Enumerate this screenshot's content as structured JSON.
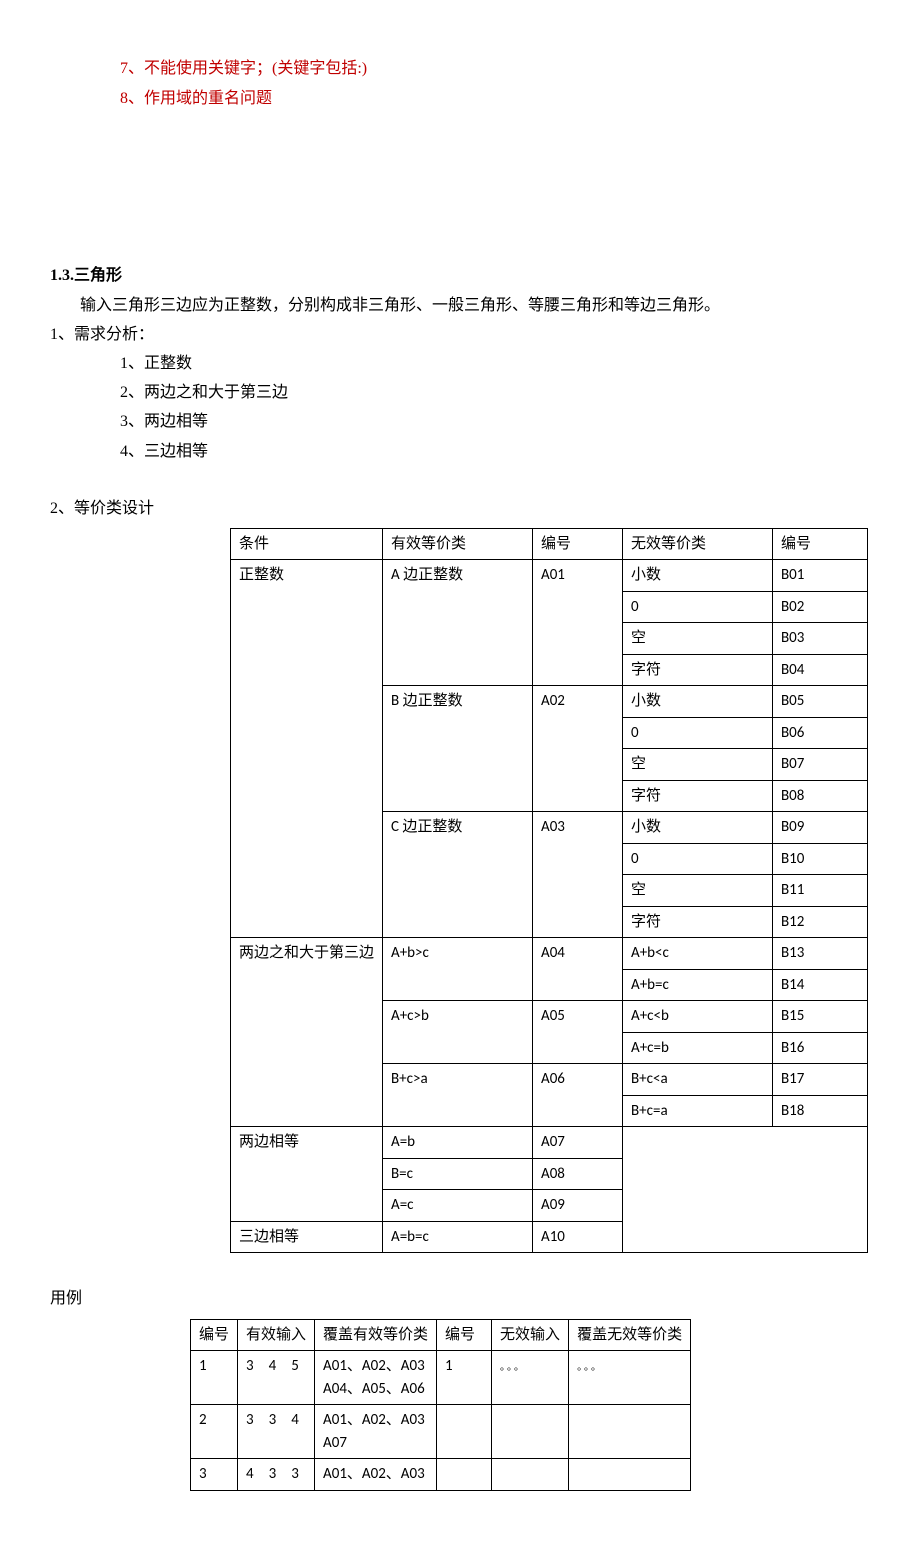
{
  "top_list": {
    "item7_num": "7、",
    "item7_text": "不能使用关键字；(关键字包括:)",
    "item8_num": "8、",
    "item8_text": "作用域的重名问题"
  },
  "section": {
    "number": "1.3.",
    "title": "三角形",
    "intro": "输入三角形三边应为正整数，分别构成非三角形、一般三角形、等腰三角形和等边三角形。"
  },
  "req": {
    "title": "1、需求分析：",
    "items": [
      {
        "num": "1、",
        "text": "正整数"
      },
      {
        "num": "2、",
        "text": "两边之和大于第三边"
      },
      {
        "num": "3、",
        "text": "两边相等"
      },
      {
        "num": "4、",
        "text": "三边相等"
      }
    ]
  },
  "eq": {
    "title": "2、等价类设计",
    "headers": [
      "条件",
      "有效等价类",
      "编号",
      "无效等价类",
      "编号"
    ],
    "rows": [
      {
        "c1": "正整数",
        "c2": "A 边正整数",
        "c3": "A01",
        "c4": "小数",
        "c5": "B01"
      },
      {
        "c4": "0",
        "c5": "B02"
      },
      {
        "c4": "空",
        "c5": "B03"
      },
      {
        "c4": "字符",
        "c5": "B04"
      },
      {
        "c2": "B 边正整数",
        "c3": "A02",
        "c4": "小数",
        "c5": "B05"
      },
      {
        "c4": "0",
        "c5": "B06"
      },
      {
        "c4": "空",
        "c5": "B07"
      },
      {
        "c4": "字符",
        "c5": "B08"
      },
      {
        "c2": "C 边正整数",
        "c3": "A03",
        "c4": "小数",
        "c5": "B09"
      },
      {
        "c4": "0",
        "c5": "B10"
      },
      {
        "c4": "空",
        "c5": "B11"
      },
      {
        "c4": "字符",
        "c5": "B12"
      },
      {
        "c1": "两边之和大于第三边",
        "c2": "A+b>c",
        "c3": "A04",
        "c4": "A+b<c",
        "c5": "B13"
      },
      {
        "c4": "A+b=c",
        "c5": "B14"
      },
      {
        "c2": "A+c>b",
        "c3": "A05",
        "c4": "A+c<b",
        "c5": "B15"
      },
      {
        "c4": "A+c=b",
        "c5": "B16"
      },
      {
        "c2": "B+c>a",
        "c3": "A06",
        "c4": "B+c<a",
        "c5": "B17"
      },
      {
        "c4": "B+c=a",
        "c5": "B18"
      },
      {
        "c1": "两边相等",
        "c2": "A=b",
        "c3": "A07"
      },
      {
        "c2": "B=c",
        "c3": "A08"
      },
      {
        "c2": "A=c",
        "c3": "A09"
      },
      {
        "c1": "三边相等",
        "c2": "A=b=c",
        "c3": "A10"
      }
    ]
  },
  "case": {
    "title": "用例",
    "headers": [
      "编号",
      "有效输入",
      "覆盖有效等价类",
      "编号",
      "无效输入",
      "覆盖无效等价类"
    ],
    "rows": [
      {
        "c1": "1",
        "c2": "3　4　5",
        "c3": "A01、A02、A03\nA04、A05、A06",
        "c4": "1",
        "c5": "。。。",
        "c6": "。。。"
      },
      {
        "c1": "2",
        "c2": "3　3　4",
        "c3": "A01、A02、A03\nA07",
        "c4": "",
        "c5": "",
        "c6": ""
      },
      {
        "c1": "3",
        "c2": "4　3　3",
        "c3": "A01、A02、A03",
        "c4": "",
        "c5": "",
        "c6": ""
      }
    ]
  }
}
